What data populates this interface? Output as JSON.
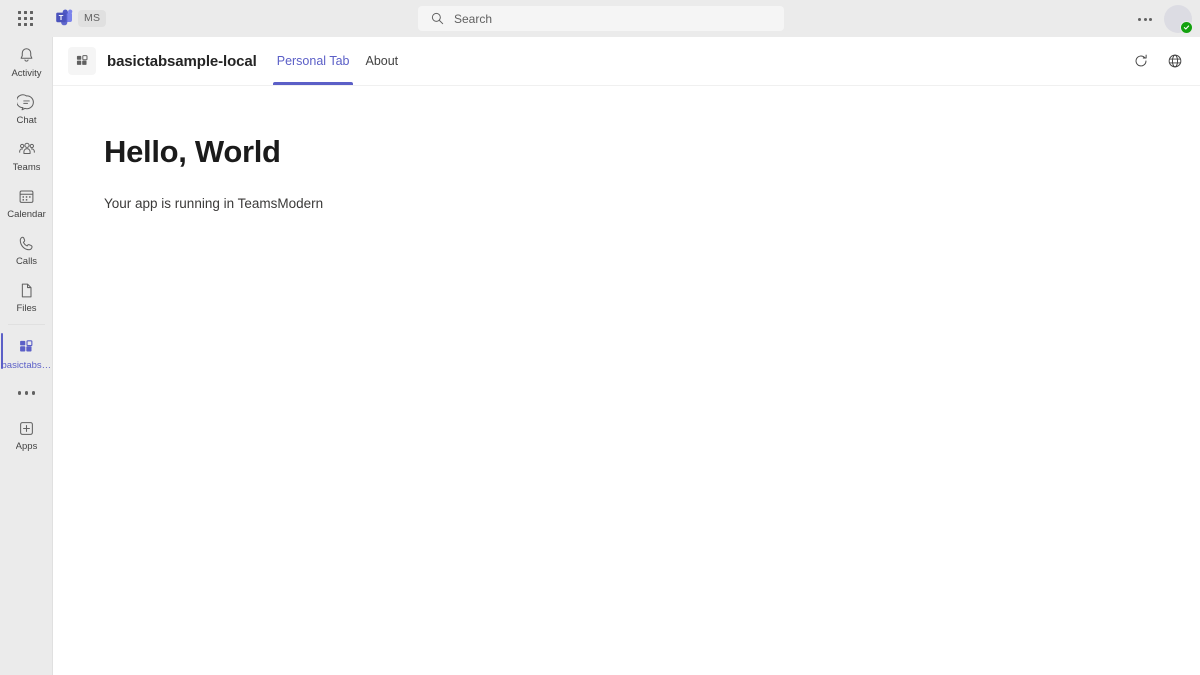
{
  "topbar": {
    "waffle_icon": "grid-apps-icon",
    "brand_icon": "teams-logo-icon",
    "tenant_badge": "MS",
    "search": {
      "icon": "search-icon",
      "placeholder": "Search",
      "value": ""
    },
    "more_label": "…",
    "more_icon": "more-horizontal-icon",
    "avatar_icon": "avatar",
    "presence": {
      "status": "Available",
      "color": "#13a10e",
      "icon": "check-icon"
    }
  },
  "rail": {
    "items": [
      {
        "label": "Activity",
        "icon": "bell-icon",
        "selected": false
      },
      {
        "label": "Chat",
        "icon": "chat-icon",
        "selected": false
      },
      {
        "label": "Teams",
        "icon": "people-icon",
        "selected": false
      },
      {
        "label": "Calendar",
        "icon": "calendar-icon",
        "selected": false
      },
      {
        "label": "Calls",
        "icon": "phone-icon",
        "selected": false
      },
      {
        "label": "Files",
        "icon": "file-icon",
        "selected": false
      },
      {
        "label": "basictabsa...",
        "icon": "apps-grid-icon",
        "selected": true
      }
    ],
    "overflow_icon": "more-horizontal-icon",
    "apps": {
      "label": "Apps",
      "icon": "add-square-icon"
    }
  },
  "app": {
    "icon": "apps-grid-icon",
    "title": "basictabsample-local",
    "tabs": [
      {
        "label": "Personal Tab",
        "active": true
      },
      {
        "label": "About",
        "active": false
      }
    ],
    "actions": [
      {
        "name": "refresh",
        "icon": "refresh-icon"
      },
      {
        "name": "open-in-browser",
        "icon": "globe-icon"
      }
    ]
  },
  "content": {
    "heading": "Hello, World",
    "subtext": "Your app is running in TeamsModern"
  },
  "colors": {
    "accent": "#5b5fc7",
    "rail_bg": "#ebebeb",
    "stage_bg": "#ffffff",
    "presence_green": "#13a10e"
  }
}
